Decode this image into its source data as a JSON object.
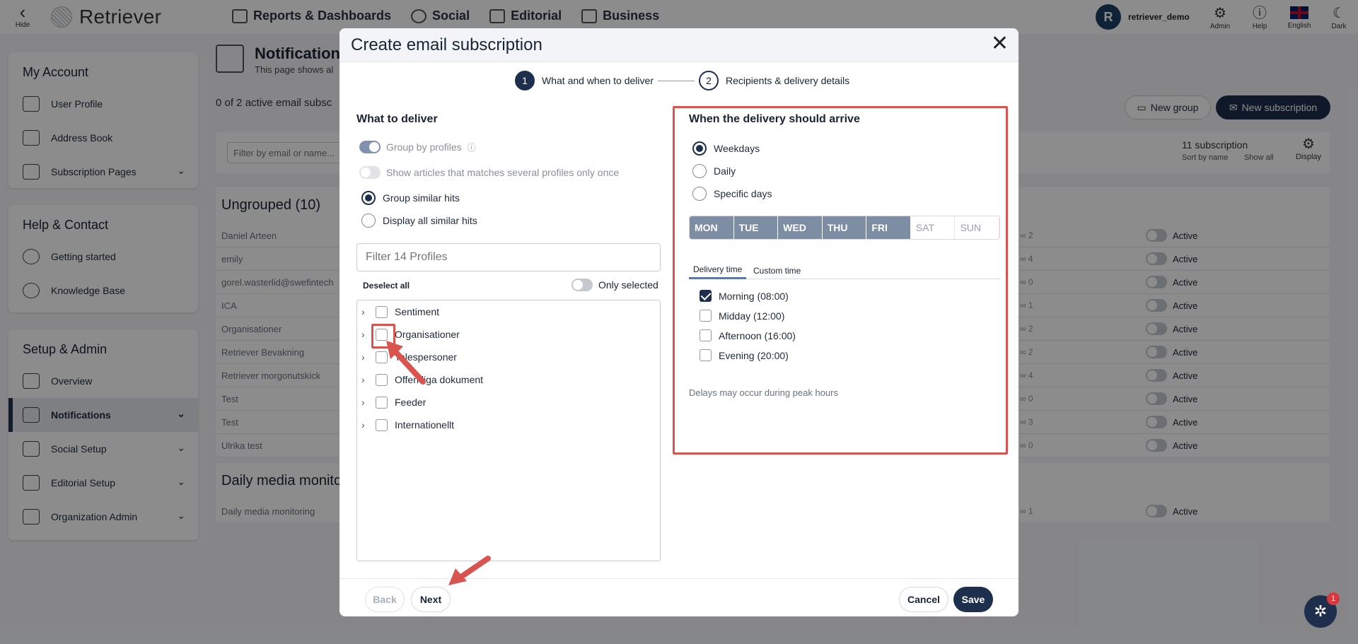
{
  "topbar": {
    "hide_label": "Hide",
    "brand": "Retriever",
    "nav": [
      "Reports & Dashboards",
      "Social",
      "Editorial",
      "Business"
    ],
    "user_initial": "R",
    "username": "retriever_demo",
    "tools": {
      "admin": "Admin",
      "help": "Help",
      "language": "English",
      "dark": "Dark"
    }
  },
  "sidebar": {
    "my_account": {
      "title": "My Account",
      "items": [
        "User Profile",
        "Address Book",
        "Subscription Pages"
      ]
    },
    "help": {
      "title": "Help & Contact",
      "items": [
        "Getting started",
        "Knowledge Base"
      ]
    },
    "setup": {
      "title": "Setup & Admin",
      "items": [
        "Overview",
        "Notifications",
        "Social Setup",
        "Editorial Setup",
        "Organization Admin"
      ]
    }
  },
  "page": {
    "title": "Notification",
    "subtitle": "This page shows al",
    "active_count": "0 of 2 active email subsc",
    "new_group": "New group",
    "new_subscription": "New subscription",
    "filter_placeholder": "Filter by email or name...",
    "subscription_count": "11 subscription",
    "sort_by": "Sort by name",
    "show_all": "Show all",
    "display": "Display",
    "group1_title": "Ungrouped (10)",
    "group1_rows": [
      {
        "name": "Daniel Arteen",
        "count": "2",
        "status": "Active"
      },
      {
        "name": "emily",
        "count": "4",
        "status": "Active"
      },
      {
        "name": "gorel.waster​lid@swefintech",
        "count": "0",
        "status": "Active"
      },
      {
        "name": "ICA",
        "count": "1",
        "status": "Active"
      },
      {
        "name": "Organisationer",
        "count": "2",
        "status": "Active"
      },
      {
        "name": "Retriever Bevakning",
        "count": "2",
        "status": "Active"
      },
      {
        "name": "Retriever morgonutskick",
        "count": "4",
        "status": "Active"
      },
      {
        "name": "Test",
        "count": "0",
        "status": "Active"
      },
      {
        "name": "Test",
        "count": "3",
        "status": "Active"
      },
      {
        "name": "Ulrika test",
        "count": "0",
        "status": "Active"
      }
    ],
    "group2_title": "Daily media monito",
    "group2_rows": [
      {
        "name": "Daily media monitoring",
        "count": "1",
        "status": "Active"
      }
    ]
  },
  "modal": {
    "title": "Create email subscription",
    "step1_num": "1",
    "step1": "What and when to deliver",
    "step2_num": "2",
    "step2": "Recipients & delivery details",
    "what_title": "What to deliver",
    "group_by_profiles": "Group by profiles",
    "show_once": "Show articles that matches several profiles only once",
    "group_similar": "Group similar hits",
    "display_all": "Display all similar hits",
    "filter_placeholder": "Filter 14 Profiles",
    "deselect_all": "Deselect all",
    "only_selected": "Only selected",
    "profiles": [
      "Sentiment",
      "Organisationer",
      "Talespersoner",
      "Offentliga dokument",
      "Feeder",
      "Internationellt"
    ],
    "when_title": "When the delivery should arrive",
    "schedule": [
      "Weekdays",
      "Daily",
      "Specific days"
    ],
    "days": [
      "MON",
      "TUE",
      "WED",
      "THU",
      "FRI",
      "SAT",
      "SUN"
    ],
    "tab_delivery": "Delivery time",
    "tab_custom": "Custom time",
    "times": [
      "Morning (08:00)",
      "Midday (12:00)",
      "Afternoon (16:00)",
      "Evening (20:00)"
    ],
    "note": "Delays may occur during peak hours",
    "back": "Back",
    "next": "Next",
    "cancel": "Cancel",
    "save": "Save"
  },
  "chat_badge": "1",
  "colors": {
    "primary": "#1d2f4d",
    "highlight": "#d9534f",
    "day_on": "#7d8da4"
  }
}
